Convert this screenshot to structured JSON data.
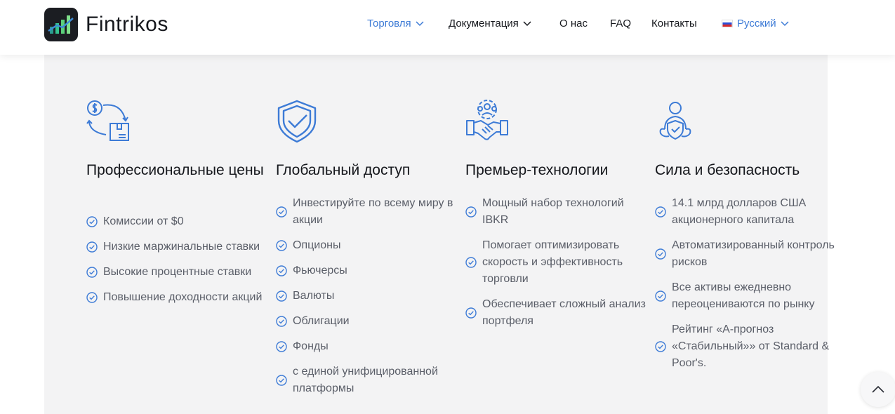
{
  "brand": {
    "name": "Fintrikos"
  },
  "nav": {
    "items": [
      {
        "label": "Торговля",
        "dropdown": true
      },
      {
        "label": "Документация",
        "dropdown": true
      },
      {
        "label": "О нас"
      },
      {
        "label": "FAQ"
      },
      {
        "label": "Контакты"
      },
      {
        "label": "Русский",
        "dropdown": true,
        "flag": "ru-flag"
      }
    ]
  },
  "features": [
    {
      "icon": "dollar-exchange-icon",
      "title": "Профессиональные цены",
      "items": [
        "Комиссии от $0",
        "Низкие маржинальные ставки",
        "Высокие процентные ставки",
        "Повышение доходности акций"
      ]
    },
    {
      "icon": "shield-check-icon",
      "title": "Глобальный доступ",
      "items": [
        "Инвестируйте по всему миру в акции",
        "Опционы",
        "Фьючерсы",
        "Валюты",
        "Облигации",
        "Фонды",
        "с единой унифицированной платформы"
      ]
    },
    {
      "icon": "handshake-gear-icon",
      "title": "Премьер-технологии",
      "items": [
        "Мощный набор технологий IBKR",
        "Помогает оптимизировать скорость и эффективность торговли",
        "Обеспечивает сложный анализ портфеля"
      ]
    },
    {
      "icon": "person-shield-icon",
      "title": "Сила и безопасность",
      "items": [
        "14.1 млрд долларов США акционерного капитала",
        "Автоматизированный контроль рисков",
        "Все активы ежедневно переоцениваются по рынку",
        "Рейтинг «A-прогноз «Стабильный»» от Standard & Poor's."
      ]
    }
  ],
  "colors": {
    "accent": "#3d7bd6",
    "panel": "#f3f3f4",
    "logo_bg": "#1b1d22"
  }
}
